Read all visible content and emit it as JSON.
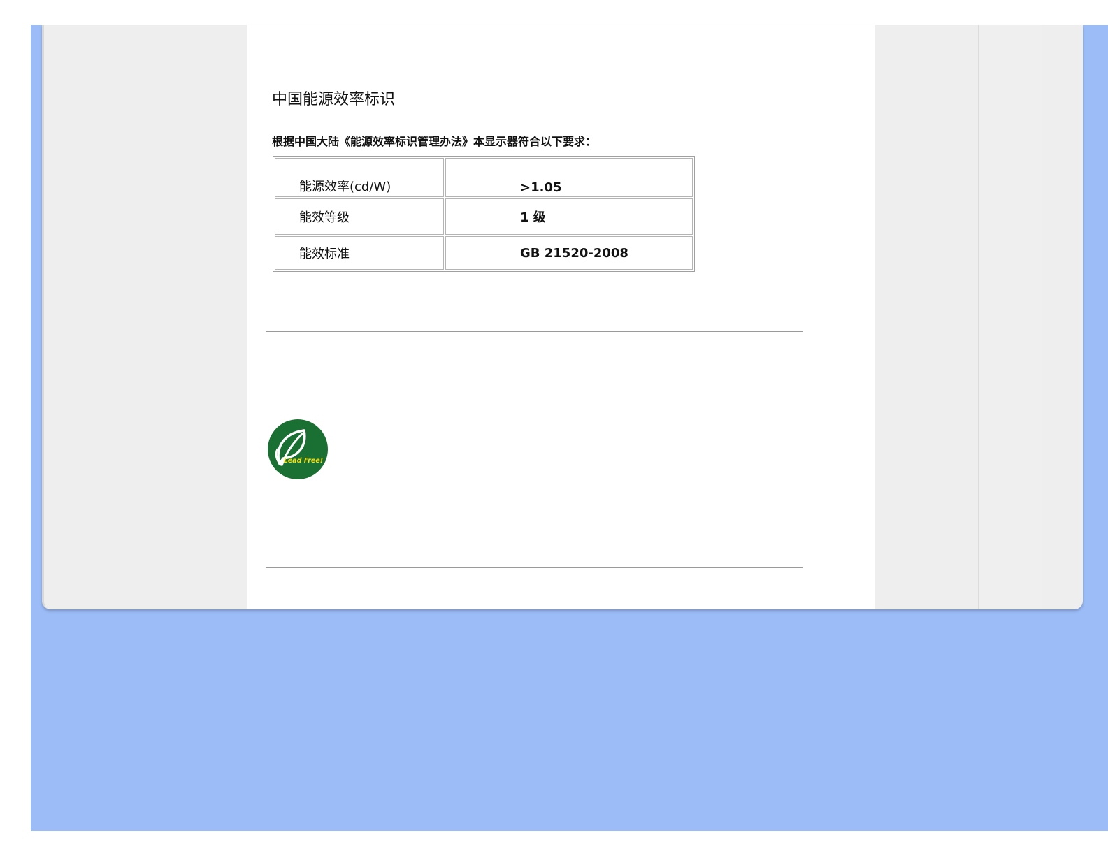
{
  "heading": "中国能源效率标识",
  "intro": "根据中国大陆《能源效率标识管理办法》本显示器符合以下要求：",
  "spec_rows": [
    {
      "label": "能源效率(cd/W)",
      "value": ">1.05"
    },
    {
      "label": "能效等级",
      "value": "1 级"
    },
    {
      "label": "能效标准",
      "value": "GB 21520-2008"
    }
  ],
  "lead_free_badge": {
    "text": "Lead Free!",
    "icon": "leaf-icon",
    "color": "#1a6f33",
    "text_color": "#f2e21e"
  },
  "colors": {
    "page_background": "#9bbcf7",
    "panel": "#eeeeee",
    "content": "#ffffff"
  }
}
